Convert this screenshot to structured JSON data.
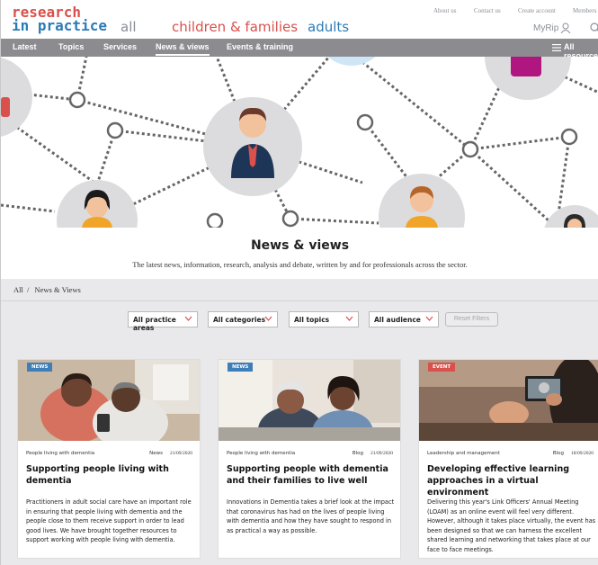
{
  "header": {
    "logo_line1": "research",
    "logo_line2": "in practice",
    "audiences": [
      "all",
      "children & families",
      "adults"
    ],
    "links": [
      "About us",
      "Contact us",
      "Create account",
      "Members"
    ],
    "myrip": "MyRip"
  },
  "nav": {
    "items": [
      "Latest",
      "Topics",
      "Services",
      "News & views",
      "Events & training"
    ],
    "active": "News & views",
    "all_resources": "All resources"
  },
  "page": {
    "title": "News & views",
    "subtitle": "The latest news, information, research, analysis and debate, written by and for professionals across the sector."
  },
  "breadcrumb": [
    "All",
    "/",
    "News & Views"
  ],
  "filters": {
    "selects": [
      "All practice areas",
      "All categories",
      "All topics",
      "All audience"
    ],
    "reset": "Reset Filters"
  },
  "cards": [
    {
      "badge": "NEWS",
      "area": "People living with dementia",
      "type": "News",
      "date": "21/09/2020",
      "title": "Supporting people living with dementia",
      "text": "Practitioners in adult social care have an important role in ensuring that people living with dementia and the people close to them receive support in order to lead good lives. We have brought together resources to support working with people living with dementia."
    },
    {
      "badge": "NEWS",
      "area": "People living with dementia",
      "type": "Blog",
      "date": "21/09/2020",
      "title": "Supporting people with dementia and their families to live well",
      "text": "Innovations in Dementia takes a brief look at the impact that coronavirus has had on the lives of people living with dementia and how they have sought to respond in as practical a way as possible."
    },
    {
      "badge": "EVENT",
      "area": "Leadership and management",
      "type": "Blog",
      "date": "18/09/2020",
      "title": "Developing effective learning approaches in a virtual environment",
      "text": "Delivering this year's Link Officers' Annual Meeting (LOAM) as an online event will feel very different. However, although it takes place virtually, the event has been designed so that we can harness the excellent shared learning and networking that takes place at our face to face meetings."
    }
  ],
  "colors": {
    "brand_red": "#d9514d",
    "brand_blue": "#2c7bb6",
    "nav_grey": "#8c8c90",
    "news_badge": "#3f7fb8",
    "event_badge": "#d9514d"
  }
}
